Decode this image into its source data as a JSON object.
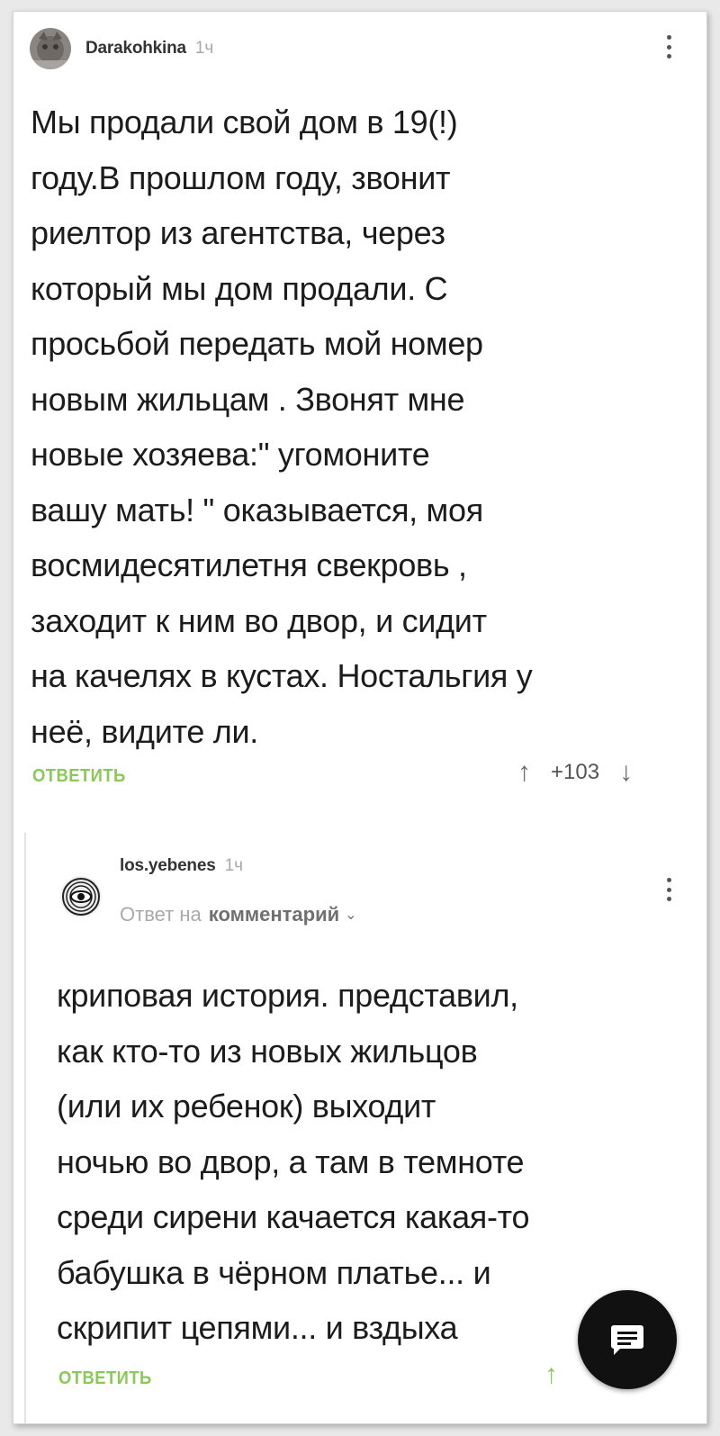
{
  "comment": {
    "author": "Darakohkina",
    "time": "1ч",
    "lines": [
      "Мы продали свой дом в 19(!)",
      "году.В прошлом году, звонит",
      "риелтор из агентства, через",
      "который мы дом продали. С",
      "просьбой передать мой номер",
      "новым жильцам . Звонят мне",
      "новые хозяева:\" угомоните",
      "вашу мать! \" оказывается, моя",
      "восмидесятилетня свекровь ,",
      "заходит к ним во двор, и сидит",
      "на качелях в кустах. Ностальгия у",
      "неё, видите ли."
    ],
    "reply_label": "ОТВЕТИТЬ",
    "score": "+103"
  },
  "reply": {
    "author": "los.yebenes",
    "time": "1ч",
    "reply_to_prefix": "Ответ на",
    "reply_to_link": "комментарий",
    "lines": [
      "криповая история. представил,",
      "как кто-то из новых жильцов",
      "(или их ребенок) выходит",
      "ночью во двор, а там в темноте",
      "среди сирени качается какая-то",
      "бабушка в чёрном платье... и",
      "скрипит цепями... и вздыха"
    ],
    "reply_label": "ОТВЕТИТЬ"
  },
  "icons": {
    "more": "more-vertical-icon",
    "up": "arrow-up-icon",
    "down": "arrow-down-icon",
    "chat": "chat-icon",
    "chevron": "chevron-down-icon"
  },
  "colors": {
    "accent": "#8ac858",
    "fab": "#111111"
  }
}
